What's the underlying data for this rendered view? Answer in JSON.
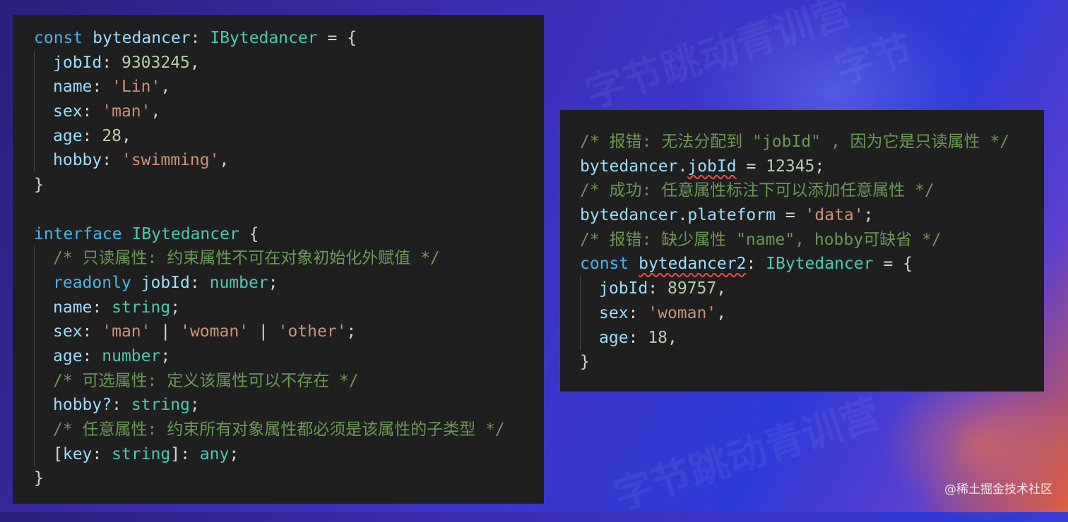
{
  "watermark": "@稀土掘金技术社区",
  "left_code": {
    "l1": [
      "const",
      "bytedancer",
      ":",
      "IBytedancer",
      "=",
      "{"
    ],
    "l2": [
      "jobId",
      ":",
      "9303245",
      ","
    ],
    "l3": [
      "name",
      ":",
      "'Lin'",
      ","
    ],
    "l4": [
      "sex",
      ":",
      "'man'",
      ","
    ],
    "l5": [
      "age",
      ":",
      "28",
      ","
    ],
    "l6": [
      "hobby",
      ":",
      "'swimming'",
      ","
    ],
    "l7": "}",
    "l9": [
      "interface",
      "IBytedancer",
      "{"
    ],
    "l10": "/* 只读属性: 约束属性不可在对象初始化外赋值 */",
    "l11": [
      "readonly",
      "jobId",
      ":",
      "number",
      ";"
    ],
    "l12": [
      "name",
      ":",
      "string",
      ";"
    ],
    "l13": [
      "sex",
      ":",
      "'man'",
      "|",
      "'woman'",
      "|",
      "'other'",
      ";"
    ],
    "l14": [
      "age",
      ":",
      "number",
      ";"
    ],
    "l15": "/* 可选属性: 定义该属性可以不存在 */",
    "l16": [
      "hobby?",
      ":",
      "string",
      ";"
    ],
    "l17": "/* 任意属性: 约束所有对象属性都必须是该属性的子类型 */",
    "l18": [
      "[",
      "key",
      ":",
      "string",
      "]",
      ":",
      "any",
      ";"
    ],
    "l19": "}"
  },
  "right_code": {
    "r1": "/* 报错: 无法分配到 \"jobId\" , 因为它是只读属性 */",
    "r2": [
      "bytedancer",
      ".",
      "jobId",
      "=",
      "12345",
      ";"
    ],
    "r3": "/* 成功: 任意属性标注下可以添加任意属性 */",
    "r4": [
      "bytedancer",
      ".",
      "plateform",
      "=",
      "'data'",
      ";"
    ],
    "r5": "/* 报错: 缺少属性 \"name\", hobby可缺省 */",
    "r6": [
      "const",
      "bytedancer2",
      ":",
      "IBytedancer",
      "=",
      "{"
    ],
    "r7": [
      "jobId",
      ":",
      "89757",
      ","
    ],
    "r8": [
      "sex",
      ":",
      "'woman'",
      ","
    ],
    "r9": [
      "age",
      ":",
      "18",
      ","
    ],
    "r10": "}"
  },
  "colors": {
    "keyword": "#4fb2e8",
    "identifier": "#9cdcfe",
    "type": "#4ec9b0",
    "string": "#ce9178",
    "number": "#b5cea8",
    "comment": "#6a9955",
    "error_underline": "#f14c4c",
    "panel_bg": "#1f1f1f"
  }
}
